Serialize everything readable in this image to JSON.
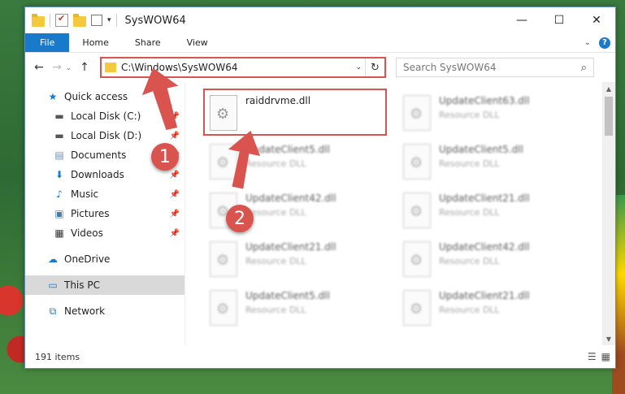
{
  "window": {
    "title": "SysWOW64"
  },
  "controls": {
    "minimize": "—",
    "maximize": "☐",
    "close": "✕"
  },
  "ribbon": {
    "tabs": [
      "File",
      "Home",
      "Share",
      "View"
    ]
  },
  "address": {
    "path": "C:\\Windows\\SysWOW64"
  },
  "search": {
    "placeholder": "Search SysWOW64"
  },
  "nav": {
    "items": [
      {
        "label": "Quick access",
        "icon": "star-icon"
      },
      {
        "label": "Local Disk (C:)",
        "icon": "drive-icon",
        "pinned": true
      },
      {
        "label": "Local Disk (D:)",
        "icon": "drive-icon",
        "pinned": true
      },
      {
        "label": "Documents",
        "icon": "documents-icon",
        "pinned": true
      },
      {
        "label": "Downloads",
        "icon": "downloads-icon",
        "pinned": true
      },
      {
        "label": "Music",
        "icon": "music-icon",
        "pinned": true
      },
      {
        "label": "Pictures",
        "icon": "pictures-icon",
        "pinned": true
      },
      {
        "label": "Videos",
        "icon": "videos-icon",
        "pinned": true
      },
      {
        "label": "OneDrive",
        "icon": "cloud-icon"
      },
      {
        "label": "This PC",
        "icon": "pc-icon",
        "selected": true
      },
      {
        "label": "Network",
        "icon": "network-icon"
      }
    ]
  },
  "files": [
    {
      "name": "raiddrvme.dll",
      "type": ""
    },
    {
      "name": "UpdateClient63.dll",
      "type": "Resource DLL"
    },
    {
      "name": "UpdateClient5.dll",
      "type": "Resource DLL"
    },
    {
      "name": "UpdateClient5.dll",
      "type": "Resource DLL"
    },
    {
      "name": "UpdateClient42.dll",
      "type": "Resource DLL"
    },
    {
      "name": "UpdateClient21.dll",
      "type": "Resource DLL"
    },
    {
      "name": "UpdateClient21.dll",
      "type": "Resource DLL"
    },
    {
      "name": "UpdateClient42.dll",
      "type": "Resource DLL"
    },
    {
      "name": "UpdateClient5.dll",
      "type": "Resource DLL"
    },
    {
      "name": "UpdateClient21.dll",
      "type": "Resource DLL"
    }
  ],
  "status": {
    "items": "191 items"
  },
  "callouts": {
    "one": "1",
    "two": "2"
  },
  "colors": {
    "accent": "#1979ca",
    "highlight": "#d9534f"
  }
}
